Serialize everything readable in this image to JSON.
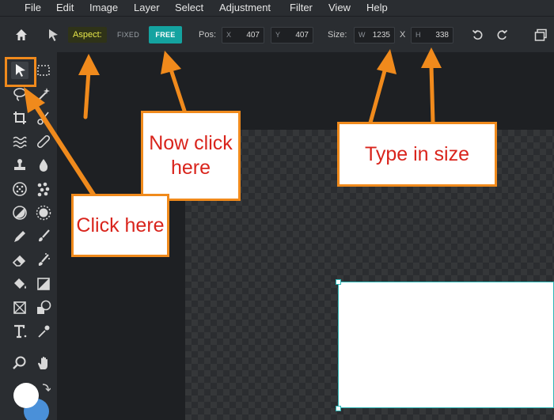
{
  "menu": [
    "File",
    "Edit",
    "Image",
    "Layer",
    "Select",
    "Adjustment",
    "Filter",
    "View",
    "Help"
  ],
  "toolbar": {
    "aspect_label": "Aspect:",
    "fixed_label": "FIXED",
    "free_label": "FREE",
    "pos_label": "Pos:",
    "pos_x_prefix": "X",
    "pos_x_value": "407",
    "pos_y_prefix": "Y",
    "pos_y_value": "407",
    "size_label": "Size:",
    "width_prefix": "W",
    "width_value": "1235",
    "size_separator": "X",
    "height_prefix": "H",
    "height_value": "338"
  },
  "icons": {
    "home": "home-icon",
    "select_arrow": "arrow-icon",
    "undo": "undo-icon",
    "redo": "redo-icon",
    "windows": "windows-icon"
  },
  "tools": [
    "select-tool",
    "marquee-tool",
    "lasso-tool",
    "magic-wand-tool",
    "crop-tool",
    "cut-tool",
    "liquify-tool",
    "heal-tool",
    "stamp-tool",
    "blur-tool",
    "sponge-tool",
    "dots-tool",
    "dodge-tool",
    "burn-tool",
    "pencil-tool",
    "brush-tool",
    "eraser-tool",
    "spray-tool",
    "fill-tool",
    "gradient-tool",
    "placeholder-tool",
    "shape-tool",
    "text-tool",
    "eyedropper-tool",
    "zoom-tool",
    "hand-tool"
  ],
  "colors": {
    "accent": "#14a3a0",
    "annotation": "#f08a1c",
    "annotation_text": "#d9241c",
    "primary_swatch": "#ffffff",
    "secondary_swatch": "#4a90d9"
  },
  "annotations": {
    "now_click_here": "Now click here",
    "type_in_size": "Type in size",
    "click_here": "Click here"
  }
}
